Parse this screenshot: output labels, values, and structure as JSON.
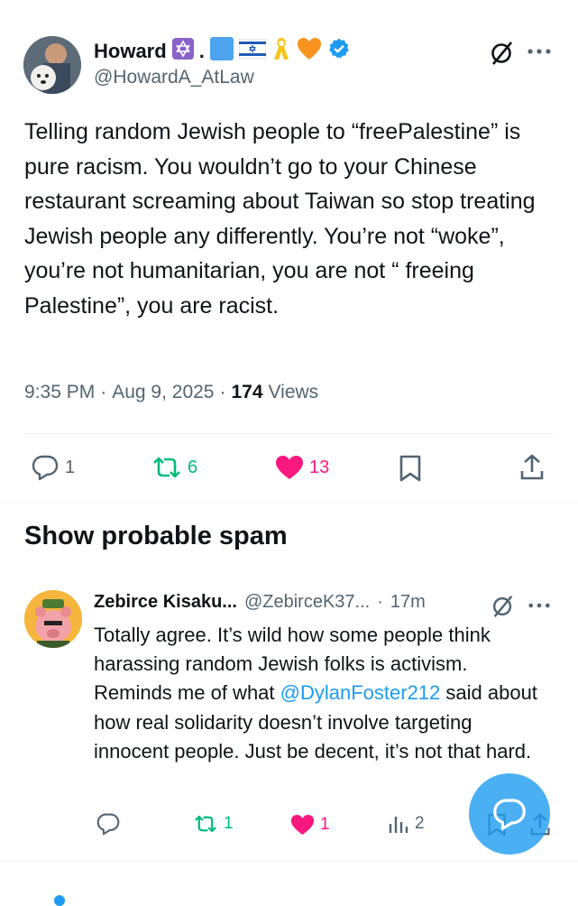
{
  "main_tweet": {
    "author_name": "Howard",
    "handle": "@HowardA_AtLaw",
    "text": "Telling random Jewish people to “freePalestine” is pure racism. You wouldn’t go to your Chinese restaurant screaming about Taiwan so stop treating Jewish people any differently. You’re not “woke”, you’re not humanitarian, you are not “ freeing Palestine”, you are racist.",
    "time": "9:35 PM",
    "date": "Aug 9, 2025",
    "views_count": "174",
    "views_label": "Views",
    "stats": {
      "replies": "1",
      "reposts": "6",
      "likes": "13"
    }
  },
  "spam_section": {
    "label": "Show probable spam"
  },
  "reply": {
    "author_name": "Zebirce Kisaku...",
    "handle": "@ZebirceK37...",
    "time_ago": "17m",
    "text_before": "Totally agree. It’s wild how some people think harassing random Jewish folks is activism. Reminds me of what ",
    "mention": "@DylanFoster212",
    "text_after": " said about how real solidarity doesn’t involve targeting innocent people. Just be decent, it’s not that hard.",
    "stats": {
      "reposts": "1",
      "likes": "1",
      "views": "2"
    }
  },
  "colors": {
    "accent": "#1d9bf0",
    "repost": "#00ba7c",
    "like": "#f91880",
    "muted": "#536471"
  }
}
